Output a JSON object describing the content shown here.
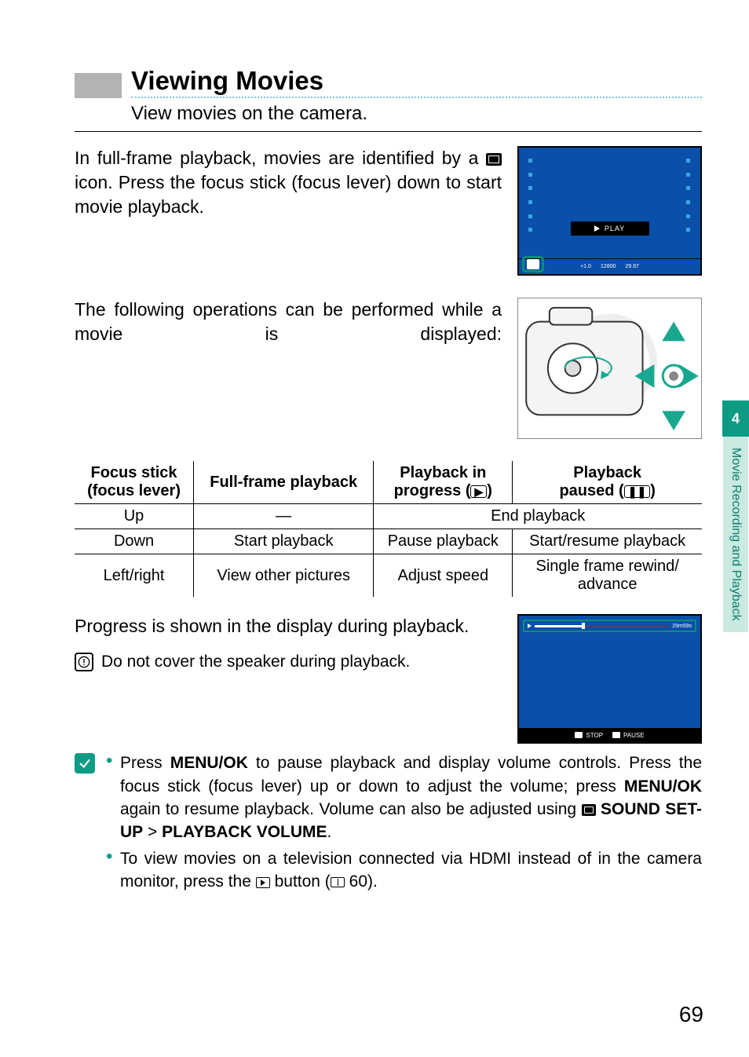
{
  "header": {
    "title": "Viewing Movies",
    "subtitle": "View movies on the camera."
  },
  "para1_a": "In full-frame playback, movies are identified by a ",
  "para1_b": " icon. Press the focus stick (focus lever) down to start movie playback.",
  "screen1": {
    "play_label": "PLAY",
    "info_left": "+1.0",
    "info_mid": "12800",
    "info_right": "29.97"
  },
  "para2": "The following operations can be performed while a movie is displayed:",
  "table": {
    "headers": {
      "h1a": "Focus stick",
      "h1b": "(focus lever)",
      "h2": "Full-frame playback",
      "h3a": "Playback in",
      "h3b": "progress (",
      "h3c": ")",
      "h4a": "Playback",
      "h4b": "paused (",
      "h4c": ")"
    },
    "rows": [
      {
        "c1": "Up",
        "c2": "—",
        "c34": "End playback"
      },
      {
        "c1": "Down",
        "c2": "Start playback",
        "c3": "Pause playback",
        "c4": "Start/resume playback"
      },
      {
        "c1": "Left/right",
        "c2": "View other pictures",
        "c3": "Adjust speed",
        "c4a": "Single frame rewind/",
        "c4b": "advance"
      }
    ]
  },
  "para3": "Progress is shown in the display during playback.",
  "screen2": {
    "time": "29m59s",
    "stop": "STOP",
    "pause": "PAUSE"
  },
  "caution": "Do not cover the speaker during playback.",
  "tips": {
    "t1_a": "Press ",
    "t1_menuok": "MENU/OK",
    "t1_b": " to pause playback and display volume controls. Press the focus stick (focus lever) up or down to adjust the volume; press ",
    "t1_c": " again to resume playback. Volume can also be adjusted using ",
    "t1_sound": " SOUND SET-UP",
    "t1_gt": " > ",
    "t1_vol": "PLAYBACK VOLUME",
    "t1_dot": ".",
    "t2_a": "To view movies on a television connected via HDMI instead of in the camera monitor, press the ",
    "t2_b": " button (",
    "t2_pg": " 60).",
    "t2_end": ""
  },
  "side": {
    "chapter": "4",
    "label": "Movie Recording and Playback"
  },
  "pageNumber": "69"
}
